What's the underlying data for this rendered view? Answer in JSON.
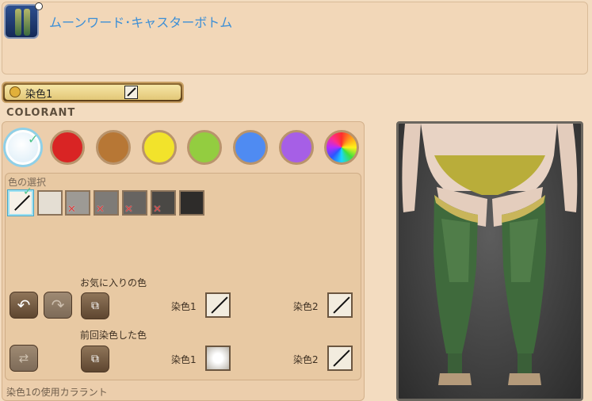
{
  "item": {
    "name": "ムーンワード･キャスターボトム"
  },
  "dye_tab": {
    "label": "染色1"
  },
  "colorant_heading": "COLORANT",
  "color_circles": [
    {
      "name": "white",
      "color": "#eaf4fb",
      "selected": true
    },
    {
      "name": "red",
      "color": "#d92424"
    },
    {
      "name": "brown",
      "color": "#b77735"
    },
    {
      "name": "yellow",
      "color": "#f2e32b"
    },
    {
      "name": "green",
      "color": "#93cd40"
    },
    {
      "name": "blue",
      "color": "#4f8bf2"
    },
    {
      "name": "purple",
      "color": "#a65fe6"
    },
    {
      "name": "rainbow",
      "color": "rainbow"
    }
  ],
  "color_select": {
    "label": "色の選択",
    "swatches": [
      {
        "name": "none",
        "color": "#f6f1e8",
        "selected": true
      },
      {
        "name": "swatch-1",
        "color": "#e4ded3",
        "unavailable": false
      },
      {
        "name": "swatch-2",
        "color": "#9d9a95",
        "unavailable": true
      },
      {
        "name": "swatch-3",
        "color": "#7e7b77",
        "unavailable": true
      },
      {
        "name": "swatch-4",
        "color": "#676461",
        "unavailable": true
      },
      {
        "name": "swatch-5",
        "color": "#4a4845",
        "unavailable": true
      },
      {
        "name": "swatch-6",
        "color": "#2e2c2a",
        "unavailable": false
      }
    ]
  },
  "favorites": {
    "heading": "お気に入りの色",
    "dye1_label": "染色1",
    "dye2_label": "染色2"
  },
  "previous": {
    "heading": "前回染色した色",
    "dye1_label": "染色1",
    "dye2_label": "染色2"
  },
  "bottom_label": "染色1の使用カララント"
}
